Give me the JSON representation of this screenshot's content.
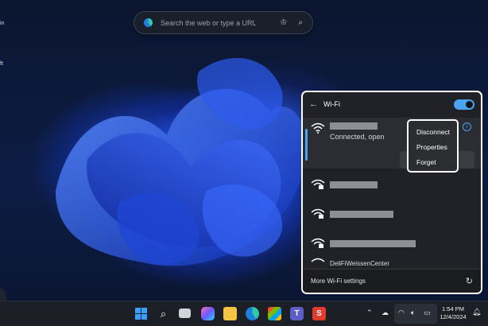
{
  "desktop": {
    "label_in": "in",
    "label_ft": "ft"
  },
  "browser_search": {
    "placeholder": "Search the web or type a URL"
  },
  "wifi_panel": {
    "title": "Wi-Fi",
    "toggle_on": true,
    "connected_network": {
      "status": "Connected, open"
    },
    "context_menu": [
      "Disconnect",
      "Properties",
      "Forget"
    ],
    "networks_count_visible": 4,
    "partial_network": "DeliFiWeissenCenter",
    "footer_link": "More Wi-Fi settings"
  },
  "taskbar": {
    "time": "1:54 PM",
    "date": "12/4/2024",
    "accent_color": "#4aa3f0"
  }
}
